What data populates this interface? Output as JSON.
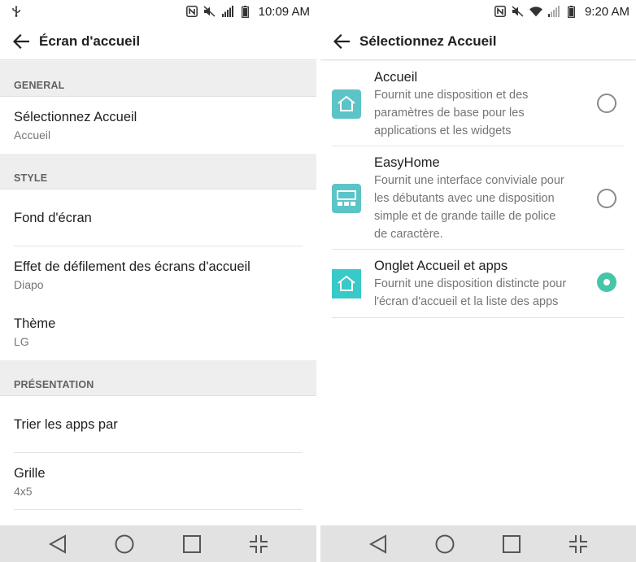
{
  "colors": {
    "accent": "#45c6a8",
    "section_bg": "#eeeeee",
    "navbar_bg": "#e2e2e2",
    "icon_teal": "#5cc4c7"
  },
  "left": {
    "status": {
      "icons": [
        "usb-icon",
        "nfc-icon",
        "mute-icon",
        "signal-icon",
        "battery-icon"
      ],
      "time": "10:09 AM"
    },
    "appbar": {
      "title": "Écran d'accueil"
    },
    "sections": [
      {
        "header": "GENERAL",
        "items": [
          {
            "title": "Sélectionnez Accueil",
            "summary": "Accueil"
          }
        ]
      },
      {
        "header": "STYLE",
        "items": [
          {
            "title": "Fond d'écran",
            "summary": ""
          },
          {
            "title": "Effet de défilement des écrans d'accueil",
            "summary": "Diapo"
          },
          {
            "title": "Thème",
            "summary": "LG"
          }
        ]
      },
      {
        "header": "PRÉSENTATION",
        "items": [
          {
            "title": "Trier les apps par",
            "summary": ""
          },
          {
            "title": "Grille",
            "summary": "4x5"
          }
        ]
      }
    ]
  },
  "right": {
    "status": {
      "icons": [
        "nfc-icon",
        "mute-icon",
        "wifi-icon",
        "signal-icon",
        "battery-icon"
      ],
      "time": "9:20 AM"
    },
    "appbar": {
      "title": "Sélectionnez Accueil"
    },
    "options": [
      {
        "title": "Accueil",
        "desc": [
          "Fournit une disposition et des",
          "paramètres de base pour les",
          "applications et les widgets"
        ],
        "selected": false,
        "icon": "home-icon"
      },
      {
        "title": "EasyHome",
        "desc": [
          "Fournit une interface conviviale pour",
          "les débutants avec une disposition",
          "simple et de grande taille de police",
          "de caractère."
        ],
        "selected": false,
        "icon": "easyhome-icon"
      },
      {
        "title": "Onglet Accueil et apps",
        "desc": [
          "Fournit une disposition distincte pour",
          "l'écran d'accueil et la liste des apps"
        ],
        "selected": true,
        "icon": "home-apps-icon"
      }
    ]
  },
  "navbar": [
    "back-icon",
    "home-icon",
    "recents-icon",
    "minimize-icon"
  ]
}
